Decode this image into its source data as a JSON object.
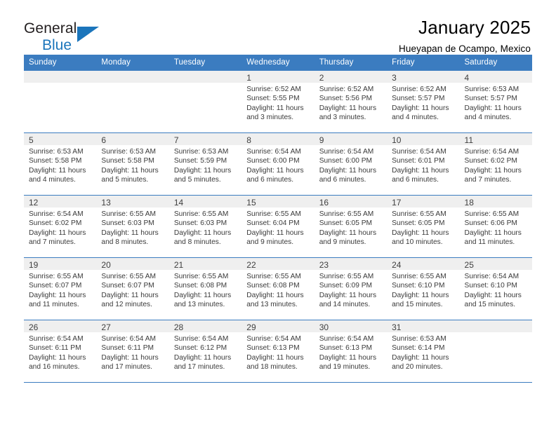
{
  "brand": {
    "name_part1": "General",
    "name_part2": "Blue",
    "logo_icon": "triangle-icon",
    "accent_color": "#1b75bb"
  },
  "header": {
    "month_title": "January 2025",
    "location": "Hueyapan de Ocampo, Mexico"
  },
  "calendar": {
    "header_bg": "#3b7cc0",
    "shade_bg": "#efefef",
    "weekday_headers": [
      "Sunday",
      "Monday",
      "Tuesday",
      "Wednesday",
      "Thursday",
      "Friday",
      "Saturday"
    ],
    "weeks": [
      [
        {
          "day": "",
          "sunrise": "",
          "sunset": "",
          "daylight": "",
          "daylight2": ""
        },
        {
          "day": "",
          "sunrise": "",
          "sunset": "",
          "daylight": "",
          "daylight2": ""
        },
        {
          "day": "",
          "sunrise": "",
          "sunset": "",
          "daylight": "",
          "daylight2": ""
        },
        {
          "day": "1",
          "sunrise": "Sunrise: 6:52 AM",
          "sunset": "Sunset: 5:55 PM",
          "daylight": "Daylight: 11 hours",
          "daylight2": "and 3 minutes."
        },
        {
          "day": "2",
          "sunrise": "Sunrise: 6:52 AM",
          "sunset": "Sunset: 5:56 PM",
          "daylight": "Daylight: 11 hours",
          "daylight2": "and 3 minutes."
        },
        {
          "day": "3",
          "sunrise": "Sunrise: 6:52 AM",
          "sunset": "Sunset: 5:57 PM",
          "daylight": "Daylight: 11 hours",
          "daylight2": "and 4 minutes."
        },
        {
          "day": "4",
          "sunrise": "Sunrise: 6:53 AM",
          "sunset": "Sunset: 5:57 PM",
          "daylight": "Daylight: 11 hours",
          "daylight2": "and 4 minutes."
        }
      ],
      [
        {
          "day": "5",
          "sunrise": "Sunrise: 6:53 AM",
          "sunset": "Sunset: 5:58 PM",
          "daylight": "Daylight: 11 hours",
          "daylight2": "and 4 minutes."
        },
        {
          "day": "6",
          "sunrise": "Sunrise: 6:53 AM",
          "sunset": "Sunset: 5:58 PM",
          "daylight": "Daylight: 11 hours",
          "daylight2": "and 5 minutes."
        },
        {
          "day": "7",
          "sunrise": "Sunrise: 6:53 AM",
          "sunset": "Sunset: 5:59 PM",
          "daylight": "Daylight: 11 hours",
          "daylight2": "and 5 minutes."
        },
        {
          "day": "8",
          "sunrise": "Sunrise: 6:54 AM",
          "sunset": "Sunset: 6:00 PM",
          "daylight": "Daylight: 11 hours",
          "daylight2": "and 6 minutes."
        },
        {
          "day": "9",
          "sunrise": "Sunrise: 6:54 AM",
          "sunset": "Sunset: 6:00 PM",
          "daylight": "Daylight: 11 hours",
          "daylight2": "and 6 minutes."
        },
        {
          "day": "10",
          "sunrise": "Sunrise: 6:54 AM",
          "sunset": "Sunset: 6:01 PM",
          "daylight": "Daylight: 11 hours",
          "daylight2": "and 6 minutes."
        },
        {
          "day": "11",
          "sunrise": "Sunrise: 6:54 AM",
          "sunset": "Sunset: 6:02 PM",
          "daylight": "Daylight: 11 hours",
          "daylight2": "and 7 minutes."
        }
      ],
      [
        {
          "day": "12",
          "sunrise": "Sunrise: 6:54 AM",
          "sunset": "Sunset: 6:02 PM",
          "daylight": "Daylight: 11 hours",
          "daylight2": "and 7 minutes."
        },
        {
          "day": "13",
          "sunrise": "Sunrise: 6:55 AM",
          "sunset": "Sunset: 6:03 PM",
          "daylight": "Daylight: 11 hours",
          "daylight2": "and 8 minutes."
        },
        {
          "day": "14",
          "sunrise": "Sunrise: 6:55 AM",
          "sunset": "Sunset: 6:03 PM",
          "daylight": "Daylight: 11 hours",
          "daylight2": "and 8 minutes."
        },
        {
          "day": "15",
          "sunrise": "Sunrise: 6:55 AM",
          "sunset": "Sunset: 6:04 PM",
          "daylight": "Daylight: 11 hours",
          "daylight2": "and 9 minutes."
        },
        {
          "day": "16",
          "sunrise": "Sunrise: 6:55 AM",
          "sunset": "Sunset: 6:05 PM",
          "daylight": "Daylight: 11 hours",
          "daylight2": "and 9 minutes."
        },
        {
          "day": "17",
          "sunrise": "Sunrise: 6:55 AM",
          "sunset": "Sunset: 6:05 PM",
          "daylight": "Daylight: 11 hours",
          "daylight2": "and 10 minutes."
        },
        {
          "day": "18",
          "sunrise": "Sunrise: 6:55 AM",
          "sunset": "Sunset: 6:06 PM",
          "daylight": "Daylight: 11 hours",
          "daylight2": "and 11 minutes."
        }
      ],
      [
        {
          "day": "19",
          "sunrise": "Sunrise: 6:55 AM",
          "sunset": "Sunset: 6:07 PM",
          "daylight": "Daylight: 11 hours",
          "daylight2": "and 11 minutes."
        },
        {
          "day": "20",
          "sunrise": "Sunrise: 6:55 AM",
          "sunset": "Sunset: 6:07 PM",
          "daylight": "Daylight: 11 hours",
          "daylight2": "and 12 minutes."
        },
        {
          "day": "21",
          "sunrise": "Sunrise: 6:55 AM",
          "sunset": "Sunset: 6:08 PM",
          "daylight": "Daylight: 11 hours",
          "daylight2": "and 13 minutes."
        },
        {
          "day": "22",
          "sunrise": "Sunrise: 6:55 AM",
          "sunset": "Sunset: 6:08 PM",
          "daylight": "Daylight: 11 hours",
          "daylight2": "and 13 minutes."
        },
        {
          "day": "23",
          "sunrise": "Sunrise: 6:55 AM",
          "sunset": "Sunset: 6:09 PM",
          "daylight": "Daylight: 11 hours",
          "daylight2": "and 14 minutes."
        },
        {
          "day": "24",
          "sunrise": "Sunrise: 6:55 AM",
          "sunset": "Sunset: 6:10 PM",
          "daylight": "Daylight: 11 hours",
          "daylight2": "and 15 minutes."
        },
        {
          "day": "25",
          "sunrise": "Sunrise: 6:54 AM",
          "sunset": "Sunset: 6:10 PM",
          "daylight": "Daylight: 11 hours",
          "daylight2": "and 15 minutes."
        }
      ],
      [
        {
          "day": "26",
          "sunrise": "Sunrise: 6:54 AM",
          "sunset": "Sunset: 6:11 PM",
          "daylight": "Daylight: 11 hours",
          "daylight2": "and 16 minutes."
        },
        {
          "day": "27",
          "sunrise": "Sunrise: 6:54 AM",
          "sunset": "Sunset: 6:11 PM",
          "daylight": "Daylight: 11 hours",
          "daylight2": "and 17 minutes."
        },
        {
          "day": "28",
          "sunrise": "Sunrise: 6:54 AM",
          "sunset": "Sunset: 6:12 PM",
          "daylight": "Daylight: 11 hours",
          "daylight2": "and 17 minutes."
        },
        {
          "day": "29",
          "sunrise": "Sunrise: 6:54 AM",
          "sunset": "Sunset: 6:13 PM",
          "daylight": "Daylight: 11 hours",
          "daylight2": "and 18 minutes."
        },
        {
          "day": "30",
          "sunrise": "Sunrise: 6:54 AM",
          "sunset": "Sunset: 6:13 PM",
          "daylight": "Daylight: 11 hours",
          "daylight2": "and 19 minutes."
        },
        {
          "day": "31",
          "sunrise": "Sunrise: 6:53 AM",
          "sunset": "Sunset: 6:14 PM",
          "daylight": "Daylight: 11 hours",
          "daylight2": "and 20 minutes."
        },
        {
          "day": "",
          "sunrise": "",
          "sunset": "",
          "daylight": "",
          "daylight2": ""
        }
      ]
    ]
  }
}
